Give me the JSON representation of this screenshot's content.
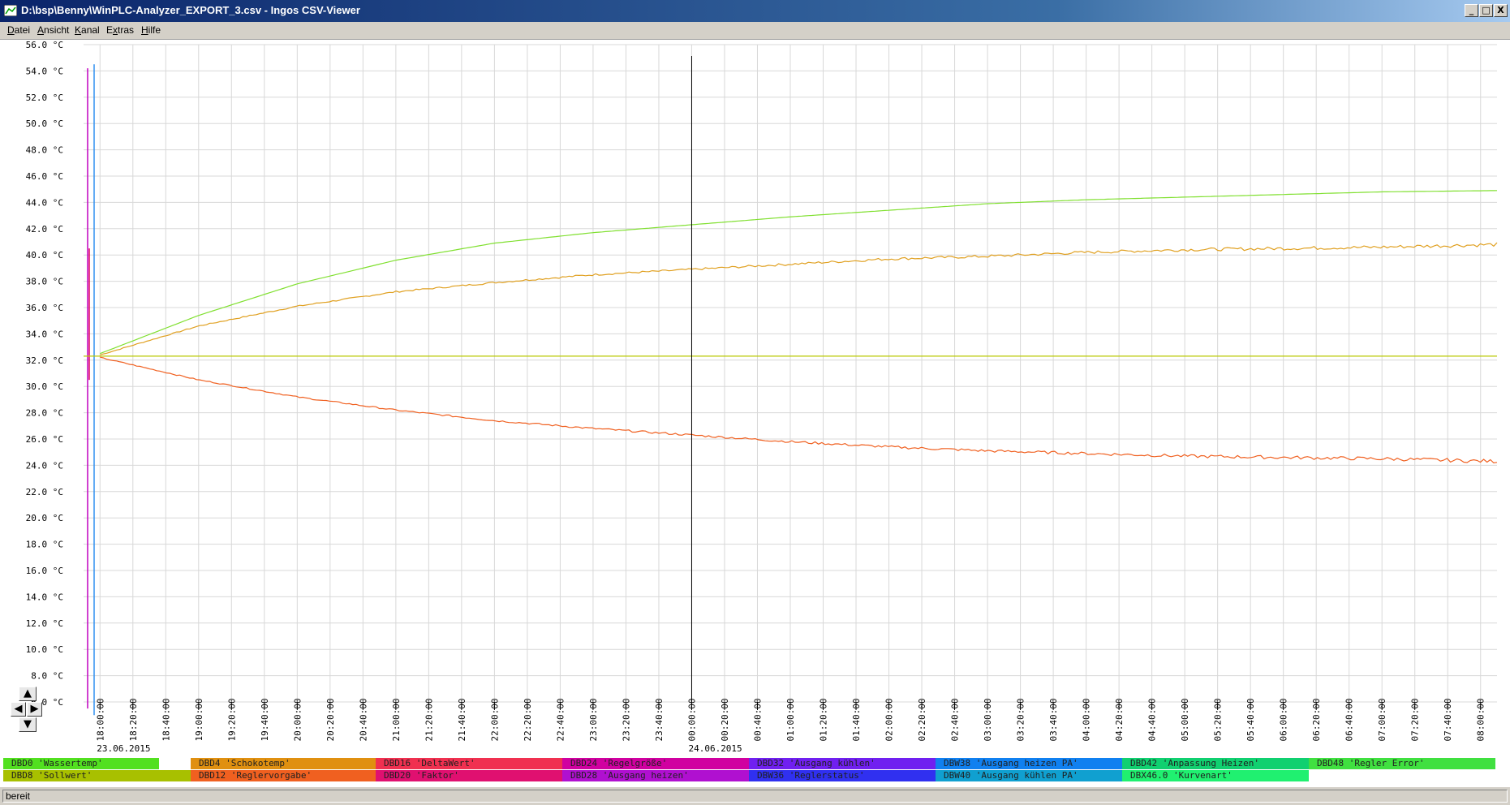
{
  "window": {
    "title": "D:\\bsp\\Benny\\WinPLC-Analyzer_EXPORT_3.csv - Ingos CSV-Viewer",
    "minimize": "_",
    "maximize": "□",
    "close": "X"
  },
  "menu": [
    {
      "pre": "",
      "u": "D",
      "post": "atei"
    },
    {
      "pre": "",
      "u": "A",
      "post": "nsicht"
    },
    {
      "pre": "",
      "u": "K",
      "post": "anal"
    },
    {
      "pre": "E",
      "u": "x",
      "post": "tras"
    },
    {
      "pre": "",
      "u": "H",
      "post": "ilfe"
    }
  ],
  "nav": {
    "up": "▲",
    "left": "◀",
    "right": "▶",
    "down": "▼"
  },
  "chart_data": {
    "type": "line",
    "ylim": [
      6,
      56
    ],
    "ystep": 2,
    "yunit": "°C",
    "y_tick_labels": [
      "56.0 °C",
      "54.0 °C",
      "52.0 °C",
      "50.0 °C",
      "48.0 °C",
      "46.0 °C",
      "44.0 °C",
      "42.0 °C",
      "40.0 °C",
      "38.0 °C",
      "36.0 °C",
      "34.0 °C",
      "32.0 °C",
      "30.0 °C",
      "28.0 °C",
      "26.0 °C",
      "24.0 °C",
      "22.0 °C",
      "20.0 °C",
      "18.0 °C",
      "16.0 °C",
      "14.0 °C",
      "12.0 °C",
      "10.0 °C",
      "8.0 °C",
      "6.0 °C"
    ],
    "x_range": [
      "23.06.2015 17:50",
      "24.06.2015 08:10"
    ],
    "x_tick_labels": [
      "18:00:00",
      "18:20:00",
      "18:40:00",
      "19:00:00",
      "19:20:00",
      "19:40:00",
      "20:00:00",
      "20:20:00",
      "20:40:00",
      "21:00:00",
      "21:20:00",
      "21:40:00",
      "22:00:00",
      "22:20:00",
      "22:40:00",
      "23:00:00",
      "23:20:00",
      "23:40:00",
      "00:00:00",
      "00:20:00",
      "00:40:00",
      "01:00:00",
      "01:20:00",
      "01:40:00",
      "02:00:00",
      "02:20:00",
      "02:40:00",
      "03:00:00",
      "03:20:00",
      "03:40:00",
      "04:00:00",
      "04:20:00",
      "04:40:00",
      "05:00:00",
      "05:20:00",
      "05:40:00",
      "06:00:00",
      "06:20:00",
      "06:40:00",
      "07:00:00",
      "07:20:00",
      "07:40:00",
      "08:00:00"
    ],
    "date_labels": [
      {
        "text": "23.06.2015",
        "at": "23.06.2015 18:00"
      },
      {
        "text": "24.06.2015",
        "at": "24.06.2015 00:00"
      }
    ],
    "cursor": "24.06.2015 00:00",
    "grid": true,
    "series": [
      {
        "name": "DBD0 'Wassertemp'",
        "color": "#80e030",
        "points": [
          [
            "23.06.2015 18:00",
            32.5
          ],
          [
            "23.06.2015 19:00",
            35.4
          ],
          [
            "23.06.2015 20:00",
            37.8
          ],
          [
            "23.06.2015 21:00",
            39.6
          ],
          [
            "23.06.2015 22:00",
            40.9
          ],
          [
            "23.06.2015 23:00",
            41.7
          ],
          [
            "24.06.2015 00:00",
            42.3
          ],
          [
            "24.06.2015 01:00",
            42.9
          ],
          [
            "24.06.2015 02:00",
            43.4
          ],
          [
            "24.06.2015 03:00",
            43.9
          ],
          [
            "24.06.2015 04:00",
            44.2
          ],
          [
            "24.06.2015 05:00",
            44.4
          ],
          [
            "24.06.2015 06:00",
            44.6
          ],
          [
            "24.06.2015 07:00",
            44.8
          ],
          [
            "24.06.2015 08:10",
            44.9
          ]
        ]
      },
      {
        "name": "DBD4 'Schokotemp'",
        "color": "#e0a020",
        "points": [
          [
            "23.06.2015 18:00",
            32.4
          ],
          [
            "23.06.2015 19:00",
            34.6
          ],
          [
            "23.06.2015 20:00",
            36.1
          ],
          [
            "23.06.2015 21:00",
            37.2
          ],
          [
            "23.06.2015 22:00",
            37.9
          ],
          [
            "23.06.2015 23:00",
            38.5
          ],
          [
            "24.06.2015 00:00",
            38.9
          ],
          [
            "24.06.2015 01:00",
            39.3
          ],
          [
            "24.06.2015 02:00",
            39.7
          ],
          [
            "24.06.2015 03:00",
            39.9
          ],
          [
            "24.06.2015 04:00",
            40.2
          ],
          [
            "24.06.2015 05:00",
            40.4
          ],
          [
            "24.06.2015 06:00",
            40.5
          ],
          [
            "24.06.2015 07:00",
            40.6
          ],
          [
            "24.06.2015 08:10",
            40.8
          ]
        ]
      },
      {
        "name": "DBD8 'Sollwert'",
        "color": "#b8c800",
        "points": [
          [
            "23.06.2015 17:50",
            32.3
          ],
          [
            "24.06.2015 08:10",
            32.3
          ]
        ]
      },
      {
        "name": "DBD12 'Reglervorgabe'",
        "color": "#f06020",
        "points": [
          [
            "23.06.2015 18:00",
            32.2
          ],
          [
            "23.06.2015 19:00",
            30.5
          ],
          [
            "23.06.2015 20:00",
            29.2
          ],
          [
            "23.06.2015 21:00",
            28.2
          ],
          [
            "23.06.2015 22:00",
            27.4
          ],
          [
            "23.06.2015 23:00",
            26.8
          ],
          [
            "24.06.2015 00:00",
            26.3
          ],
          [
            "24.06.2015 01:00",
            25.8
          ],
          [
            "24.06.2015 02:00",
            25.4
          ],
          [
            "24.06.2015 03:00",
            25.1
          ],
          [
            "24.06.2015 04:00",
            24.9
          ],
          [
            "24.06.2015 05:00",
            24.7
          ],
          [
            "24.06.2015 06:00",
            24.6
          ],
          [
            "24.06.2015 07:00",
            24.5
          ],
          [
            "24.06.2015 08:10",
            24.3
          ]
        ]
      }
    ]
  },
  "legend": {
    "row1": [
      {
        "label": "DBD0 'Wassertemp'",
        "color": "#52e020"
      },
      {
        "label": "DBD4 'Schokotemp'",
        "color": "#e09010"
      },
      {
        "label": "DBD16 'DeltaWert'",
        "color": "#f03050"
      },
      {
        "label": "DBD24 'Regelgröße'",
        "color": "#d000a0"
      },
      {
        "label": "DBD32 'Ausgang kühlen'",
        "color": "#7020f0"
      },
      {
        "label": "DBW38 'Ausgang heizen PA'",
        "color": "#1080f0"
      },
      {
        "label": "DBD42 'Anpassung Heizen'",
        "color": "#10d070"
      },
      {
        "label": "DBD48 'Regler Error'",
        "color": "#40e040"
      }
    ],
    "row2": [
      {
        "label": "DBD8 'Sollwert'",
        "color": "#a8c000"
      },
      {
        "label": "DBD12 'Reglervorgabe'",
        "color": "#f06020"
      },
      {
        "label": "DBD20 'Faktor'",
        "color": "#e01070"
      },
      {
        "label": "DBD28 'Ausgang heizen'",
        "color": "#b010d0"
      },
      {
        "label": "DBW36 'Reglerstatus'",
        "color": "#3030f0"
      },
      {
        "label": "DBW40 'Ausgang kühlen PA'",
        "color": "#10a0d0"
      },
      {
        "label": "DBX46.0 'Kurvenart'",
        "color": "#20f070"
      }
    ]
  },
  "status": "bereit"
}
